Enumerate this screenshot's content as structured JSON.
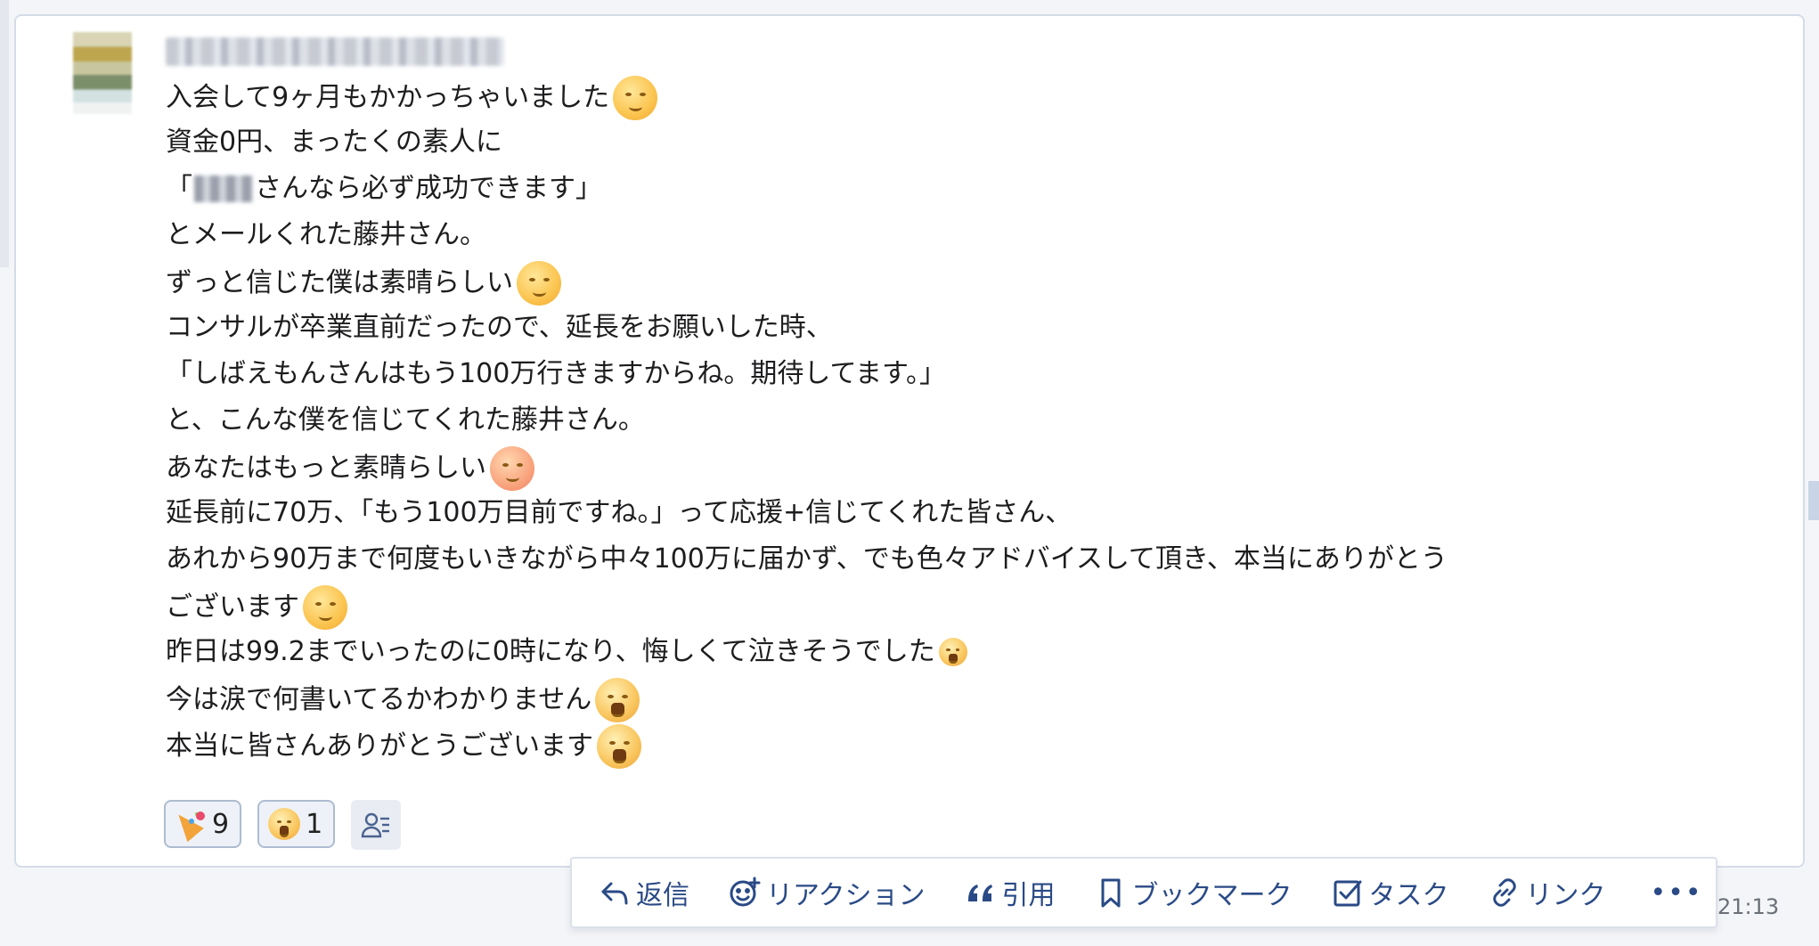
{
  "message": {
    "sender_name": "",
    "lines": [
      "入会して9ヶ月もかかっちゃいました",
      "資金0円、まったくの素人に",
      "「",
      "さんなら必ず成功できます」",
      "とメールくれた藤井さん。",
      "ずっと信じた僕は素晴らしい",
      "コンサルが卒業直前だったので、延長をお願いした時、",
      "「しばえもんさんはもう100万行きますからね。期待してます。」",
      "と、こんな僕を信じてくれた藤井さん。",
      "あなたはもっと素晴らしい",
      "延長前に70万、「もう100万目前ですね。」って応援+信じてくれた皆さん、",
      "あれから90万まで何度もいきながら中々100万に届かず、でも色々アドバイスして頂き、本当にありがとう",
      "ございます",
      "昨日は99.2までいったのに0時になり、悔しくて泣きそうでした",
      "今は涙で何書いてるかわかりません",
      "本当に皆さんありがとうございます"
    ],
    "emoji_names": [
      "relieved-face-icon",
      "yum-face-icon",
      "kissing-face-icon",
      "smiling-face-icon",
      "laughing-tears-icon",
      "crying-face-icon",
      "crying-face-icon"
    ]
  },
  "reactions": [
    {
      "icon": "party-popper-icon",
      "count": "9"
    },
    {
      "icon": "crying-face-icon",
      "count": "1"
    }
  ],
  "actions": {
    "reply": "返信",
    "reaction": "リアクション",
    "quote": "引用",
    "bookmark": "ブックマーク",
    "task": "タスク",
    "link": "リンク",
    "more": "•••"
  },
  "timestamp": "21:13",
  "colors": {
    "accent": "#2a4a86",
    "chip_border": "#aebcd0",
    "chip_bg": "#eef2f8"
  }
}
